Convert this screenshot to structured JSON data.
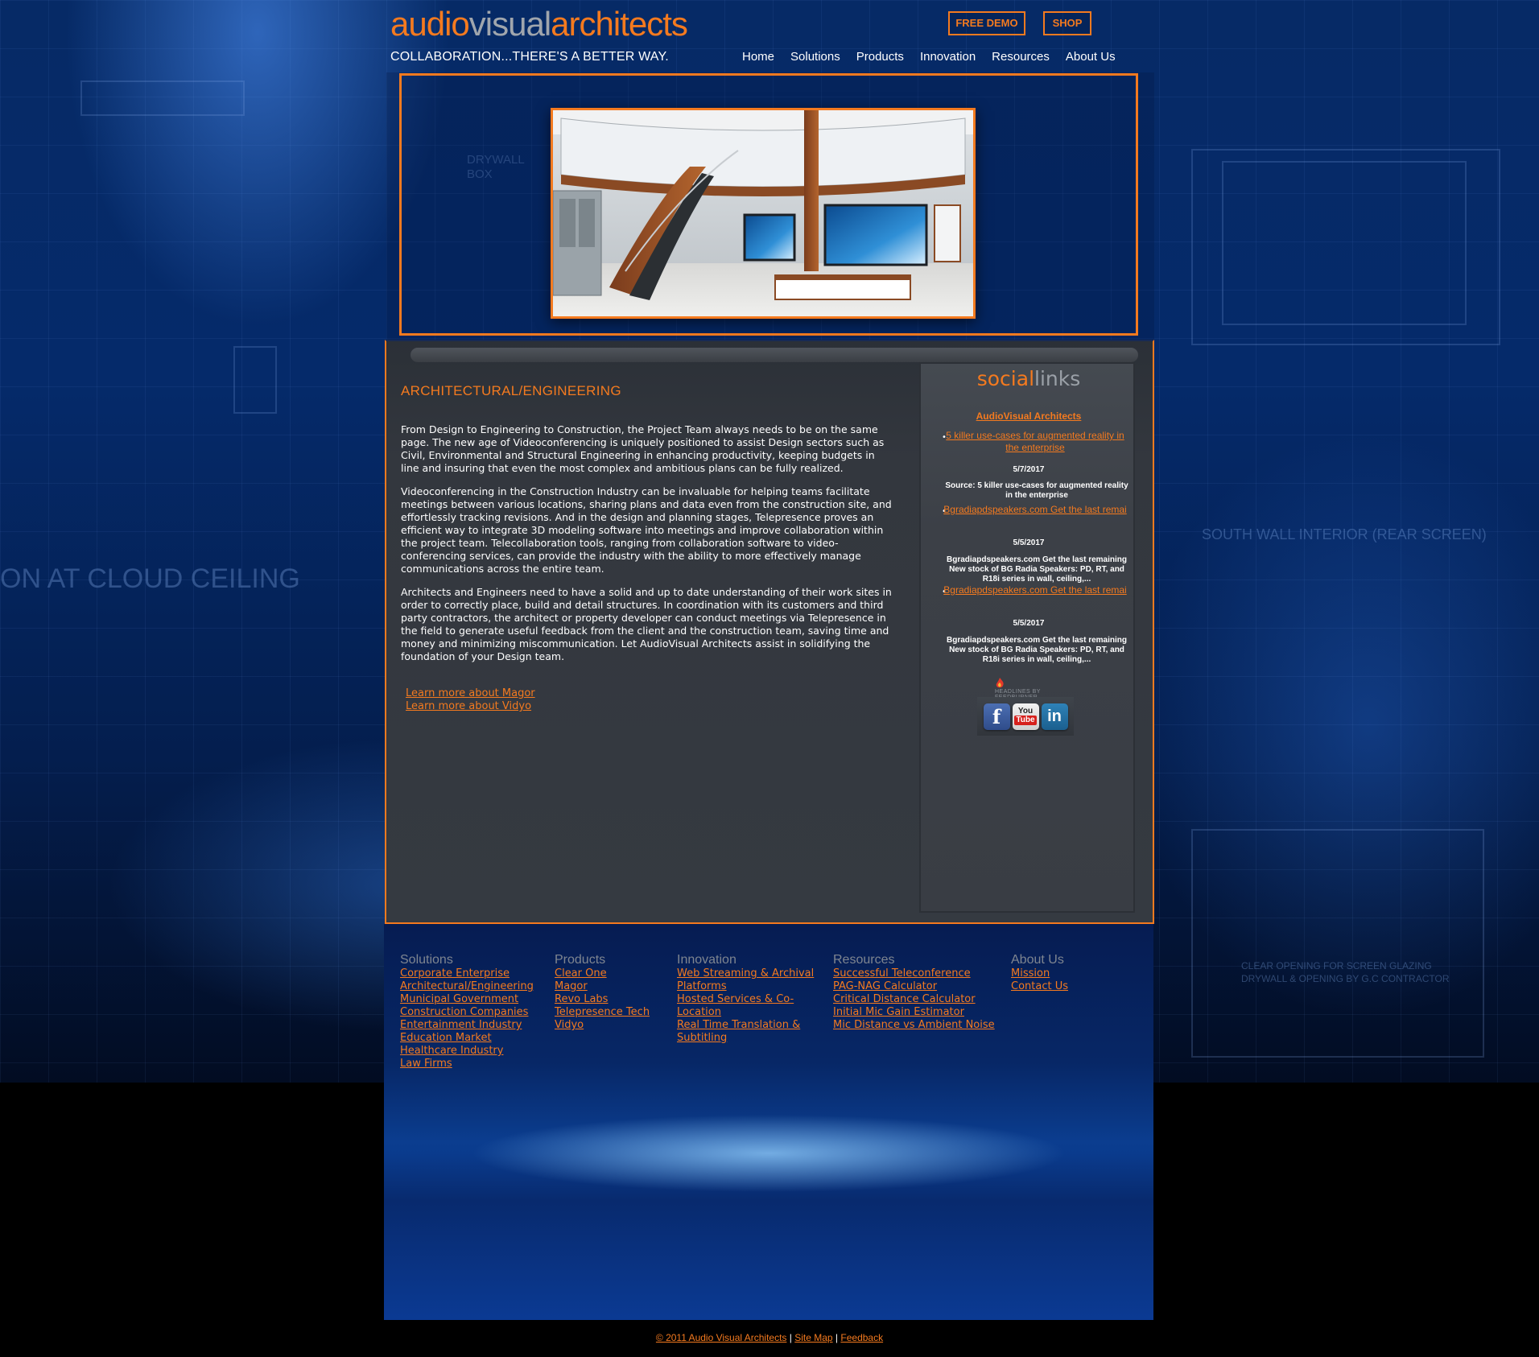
{
  "brand": {
    "logo_part1": "audio",
    "logo_part2": "visual",
    "logo_part3": "architects",
    "tagline": "COLLABORATION...THERE'S A BETTER WAY.",
    "accent_color": "#f47a1f"
  },
  "header": {
    "free_demo_label": "FREE DEMO",
    "shop_label": "SHOP"
  },
  "nav": {
    "items": [
      "Home",
      "Solutions",
      "Products",
      "Innovation",
      "Resources",
      "About Us"
    ]
  },
  "background": {
    "bp_text_1": "ON AT CLOUD CEILING",
    "bp_text_2": "SOUTH WALL INTERIOR (REAR SCREEN)",
    "bp_text_3": "DRYWALL",
    "bp_text_4": "BOX",
    "bp_text_5": "CLEAR OPENING FOR SCREEN GLAZING",
    "bp_text_6": "DRYWALL & OPENING BY G.C CONTRACTOR"
  },
  "main": {
    "heading": "ARCHITECTURAL/ENGINEERING",
    "paragraphs": [
      "From Design to Engineering to Construction, the Project Team always needs to be on the same page. The new age of Videoconferencing is uniquely positioned to assist Design sectors such as Civil, Environmental and Structural Engineering in enhancing productivity, keeping budgets in line and insuring that even the most complex and ambitious plans can be fully realized.",
      "Videoconferencing in the Construction Industry can be invaluable for helping teams facilitate meetings between various locations, sharing plans and data even from the construction site, and effortlessly tracking revisions. And in the design and planning stages, Telepresence proves an efficient way to integrate 3D modeling software into meetings and improve collaboration within the project team. Telecollaboration tools, ranging from collaboration software to video-conferencing services, can provide the industry with the ability to more effectively manage communications across the entire team.",
      "Architects and Engineers need to have a solid and up to date understanding of their work sites in order to correctly place, build and detail structures. In coordination with its customers and third party contractors, the architect or property developer can conduct meetings via Telepresence in the field to generate useful feedback from the client and the construction team, saving time and money and minimizing miscommunication. Let AudioVisual Architects assist in solidifying the foundation of your Design team."
    ],
    "learn_magor": "Learn more about Magor",
    "learn_vidyo": "Learn more about Vidyo"
  },
  "sidebar": {
    "title_part1": "social",
    "title_part2": "links",
    "feed_title": "AudioVisual Architects",
    "items": [
      {
        "link": "5 killer use-cases for augmented reality in the enterprise",
        "date": "5/7/2017",
        "desc": "Source: 5 killer use-cases for augmented reality in the enterprise"
      },
      {
        "link": "Bgradiapdspeakers.com Get the last remai",
        "date": "5/5/2017",
        "desc": "Bgradiapdspeakers.com Get the last remaining New stock of BG Radia Speakers: PD, RT, and R18i series in wall, ceiling,..."
      },
      {
        "link": "Bgradiapdspeakers.com Get the last remai",
        "date": "5/5/2017",
        "desc": "Bgradiapdspeakers.com Get the last remaining New stock of BG Radia Speakers: PD, RT, and R18i series in wall, ceiling,..."
      }
    ],
    "feedburner_line1": "HEADLINES BY",
    "feedburner_line2": "FEEDBURNER",
    "social_facebook": "f",
    "social_youtube_1": "You",
    "social_youtube_2": "Tube",
    "social_linkedin": "in"
  },
  "footer": {
    "columns": [
      {
        "heading": "Solutions",
        "links": [
          "Corporate Enterprise",
          "Architectural/Engineering",
          "Municipal Government",
          "Construction Companies",
          "Entertainment Industry",
          "Education Market",
          "Healthcare Industry",
          "Law Firms"
        ]
      },
      {
        "heading": "Products",
        "links": [
          "Clear One",
          "Magor",
          "Revo Labs",
          "Telepresence Tech",
          "Vidyo"
        ]
      },
      {
        "heading": "Innovation",
        "links": [
          "Web Streaming & Archival",
          "Platforms",
          "Hosted Services & Co-",
          "Location",
          "Real Time Translation &",
          "Subtitling"
        ]
      },
      {
        "heading": "Resources",
        "links": [
          "Successful Teleconference",
          "PAG-NAG Calculator",
          "Critical Distance Calculator",
          "Initial Mic Gain Estimator",
          "Mic Distance vs Ambient Noise"
        ]
      },
      {
        "heading": "About Us",
        "links": [
          "Mission",
          "Contact Us"
        ]
      }
    ],
    "copyright": "© 2011 Audio Visual Architects",
    "sitemap": "Site Map",
    "feedback": "Feedback",
    "separator": "|"
  }
}
